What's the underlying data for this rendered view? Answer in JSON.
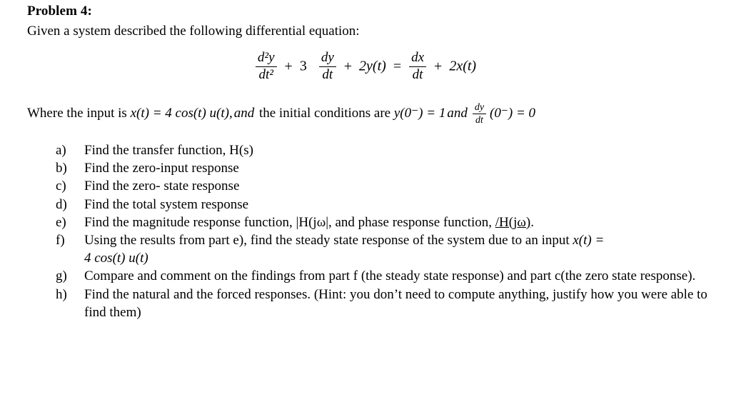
{
  "document": {
    "title": "Problem 4:",
    "intro": "Given a system described the following differential equation:"
  },
  "equation": {
    "lhs_num": "d²y",
    "lhs_den": "dt²",
    "coefficient": "3",
    "dy_num": "dy",
    "dy_den": "dt",
    "plus": "+",
    "two_y": "2y(t)",
    "equals": "=",
    "dx_num": "dx",
    "dx_den": "dt",
    "two_x": "2x(t)",
    "full_text": "d²y/dt² + 3 dy/dt + 2y(t) = dx/dt + 2x(t)"
  },
  "conditions": {
    "prefix": "Where the input is ",
    "input_expr": "x(t) = 4 cos(t) u(t),",
    "and_1": "and",
    "middle": " the initial conditions are ",
    "ic_1": "y(0⁻) = 1",
    "and_2": "and",
    "ic_2_num": "dy",
    "ic_2_den": "dt",
    "ic_2_rest": "(0⁻) = 0",
    "full_text": "Where the input is x(t) = 4 cos(t) u(t), and the initial conditions are y(0⁻) = 1 and dy/dt (0⁻) = 0"
  },
  "parts": [
    {
      "marker": "a)",
      "text": "Find the transfer function, H(s)"
    },
    {
      "marker": "b)",
      "text": "Find the zero-input response"
    },
    {
      "marker": "c)",
      "text": "Find the zero- state response"
    },
    {
      "marker": "d)",
      "text": "Find the total system response"
    },
    {
      "marker": "e)",
      "text_pre": "Find the magnitude response function, |H(jω|, and phase response function, ",
      "text_underlined": "/H(jω)",
      "text_post": "."
    },
    {
      "marker": "f)",
      "text_pre": "Using the results from part e), find the steady state response of the system due to an input ",
      "math_inline": "x(t) =",
      "text_line2": "4 cos(t) u(t)"
    },
    {
      "marker": "g)",
      "text": "Compare and comment on the findings from part f (the steady state response) and part c(the zero state response)."
    },
    {
      "marker": "h)",
      "text": "Find the natural and the forced responses. (Hint: you don’t need to compute anything, justify how you were able to find them)"
    }
  ],
  "colors": {
    "background": "#ffffff",
    "text": "#000000"
  }
}
